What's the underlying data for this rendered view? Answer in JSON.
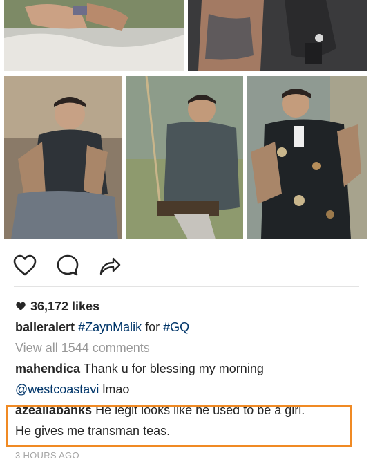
{
  "post": {
    "likes_count": "36,172 likes",
    "caption": {
      "username": "balleralert",
      "hashtag_1": "#ZaynMalik",
      "connector": " for ",
      "hashtag_2": "#GQ"
    },
    "view_all_comments": "View all 1544 comments",
    "comments": [
      {
        "username": "mahendica",
        "text": " Thank u for blessing my morning"
      },
      {
        "mention": "@westcoastavi",
        "text": " lmao"
      },
      {
        "username": "azealiabanks",
        "text": " He legit looks like he used to be a girl.",
        "continuation": "He gives me transman teas."
      }
    ],
    "timestamp": "3 HOURS AGO"
  },
  "icons": {
    "like": "heart-outline-icon",
    "comment": "speech-bubble-icon",
    "share": "share-arrow-icon",
    "likes_indicator": "heart-filled-icon"
  },
  "colors": {
    "highlight_border": "#f08a24",
    "hashtag": "#003569",
    "muted_text": "#999999",
    "timestamp_text": "#a5a5a5"
  }
}
